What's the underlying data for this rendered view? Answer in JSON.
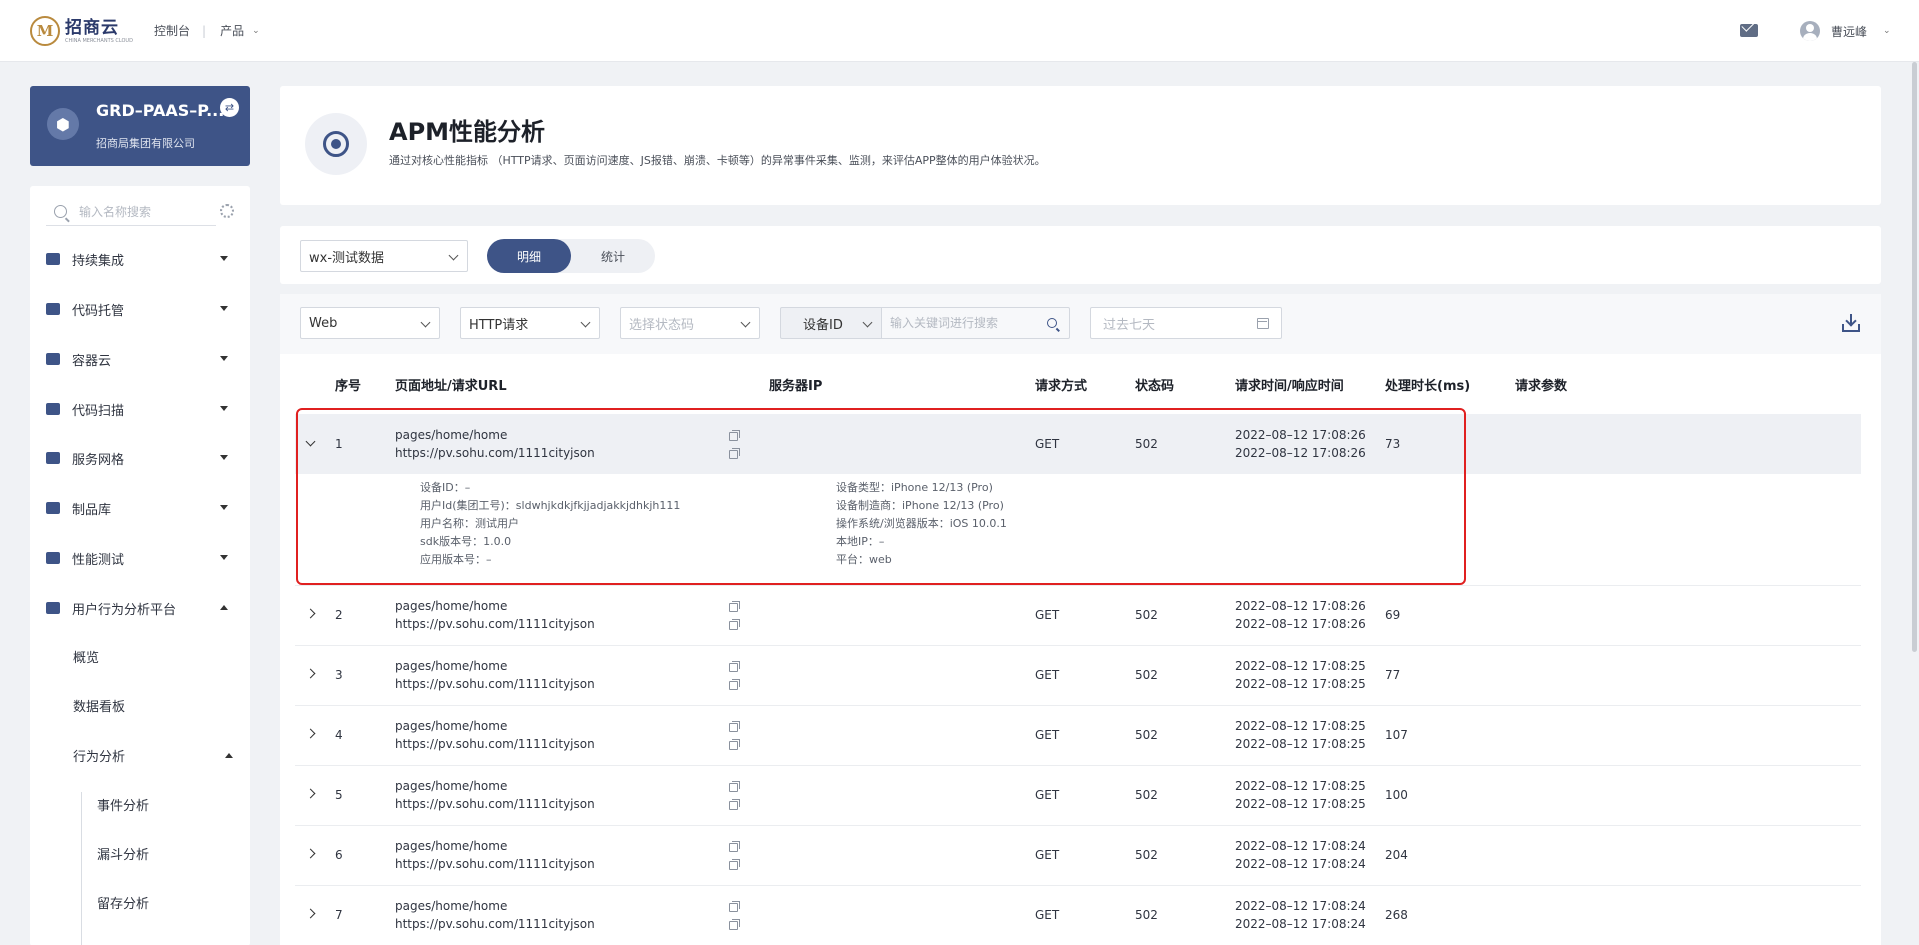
{
  "topbar": {
    "logo_text": "招商云",
    "logo_subtext": "CHINA MERCHANTS CLOUD",
    "nav": [
      {
        "label": "控制台"
      },
      {
        "label": "产品"
      }
    ],
    "user_name": "曹远峰"
  },
  "project": {
    "name": "GRD–PAAS–P...",
    "org": "招商局集团有限公司"
  },
  "sidebar": {
    "search_placeholder": "输入名称搜索",
    "menu": [
      {
        "label": "持续集成",
        "expanded": false
      },
      {
        "label": "代码托管",
        "expanded": false
      },
      {
        "label": "容器云",
        "expanded": false
      },
      {
        "label": "代码扫描",
        "expanded": false
      },
      {
        "label": "服务网格",
        "expanded": false
      },
      {
        "label": "制品库",
        "expanded": false
      },
      {
        "label": "性能测试",
        "expanded": false
      },
      {
        "label": "用户行为分析平台",
        "expanded": true
      }
    ],
    "sub_items": [
      {
        "label": "概览"
      },
      {
        "label": "数据看板"
      },
      {
        "label": "行为分析"
      }
    ],
    "sub_sub_items": [
      {
        "label": "事件分析"
      },
      {
        "label": "漏斗分析"
      },
      {
        "label": "留存分析"
      }
    ]
  },
  "header": {
    "title": "APM性能分析",
    "description": "通过对核心性能指标 （HTTP请求、页面访问速度、JS报错、崩溃、卡顿等）的异常事件采集、监测，来评估APP整体的用户体验状况。"
  },
  "view": {
    "app_select": "wx-测试数据",
    "tab_detail": "明细",
    "tab_stats": "统计",
    "active_tab": "明细"
  },
  "filters": {
    "platform": "Web",
    "type": "HTTP请求",
    "status_placeholder": "选择状态码",
    "search_field": "设备ID",
    "search_placeholder": "输入关键词进行搜索",
    "date_placeholder": "过去七天"
  },
  "table": {
    "columns": [
      "序号",
      "页面地址/请求URL",
      "服务器IP",
      "请求方式",
      "状态码",
      "请求时间/响应时间",
      "处理时长(ms)",
      "请求参数"
    ],
    "rows": [
      {
        "no": "1",
        "page": "pages/home/home",
        "url": "https://pv.sohu.com/1111cityjson",
        "method": "GET",
        "status": "502",
        "req_time": "2022–08–12 17:08:26",
        "resp_time": "2022–08–12 17:08:26",
        "duration": "73"
      },
      {
        "no": "2",
        "page": "pages/home/home",
        "url": "https://pv.sohu.com/1111cityjson",
        "method": "GET",
        "status": "502",
        "req_time": "2022–08–12 17:08:26",
        "resp_time": "2022–08–12 17:08:26",
        "duration": "69"
      },
      {
        "no": "3",
        "page": "pages/home/home",
        "url": "https://pv.sohu.com/1111cityjson",
        "method": "GET",
        "status": "502",
        "req_time": "2022–08–12 17:08:25",
        "resp_time": "2022–08–12 17:08:25",
        "duration": "77"
      },
      {
        "no": "4",
        "page": "pages/home/home",
        "url": "https://pv.sohu.com/1111cityjson",
        "method": "GET",
        "status": "502",
        "req_time": "2022–08–12 17:08:25",
        "resp_time": "2022–08–12 17:08:25",
        "duration": "107"
      },
      {
        "no": "5",
        "page": "pages/home/home",
        "url": "https://pv.sohu.com/1111cityjson",
        "method": "GET",
        "status": "502",
        "req_time": "2022–08–12 17:08:25",
        "resp_time": "2022–08–12 17:08:25",
        "duration": "100"
      },
      {
        "no": "6",
        "page": "pages/home/home",
        "url": "https://pv.sohu.com/1111cityjson",
        "method": "GET",
        "status": "502",
        "req_time": "2022–08–12 17:08:24",
        "resp_time": "2022–08–12 17:08:24",
        "duration": "204"
      },
      {
        "no": "7",
        "page": "pages/home/home",
        "url": "https://pv.sohu.com/1111cityjson",
        "method": "GET",
        "status": "502",
        "req_time": "2022–08–12 17:08:24",
        "resp_time": "2022–08–12 17:08:24",
        "duration": "268"
      }
    ],
    "detail": {
      "left": [
        "设备ID：–",
        "用户Id(集团工号)：sldwhjkdkjfkjjadjakkjdhkjh111",
        "用户名称：测试用户",
        "sdk版本号：1.0.0",
        "应用版本号：–"
      ],
      "right": [
        "设备类型：iPhone 12/13 (Pro)",
        "设备制造商：iPhone 12/13 (Pro)",
        "操作系统/浏览器版本：iOS 10.0.1",
        "本地IP：–",
        "平台：web"
      ]
    }
  },
  "colors": {
    "brand": "#3e5487",
    "highlight": "#e02020"
  }
}
